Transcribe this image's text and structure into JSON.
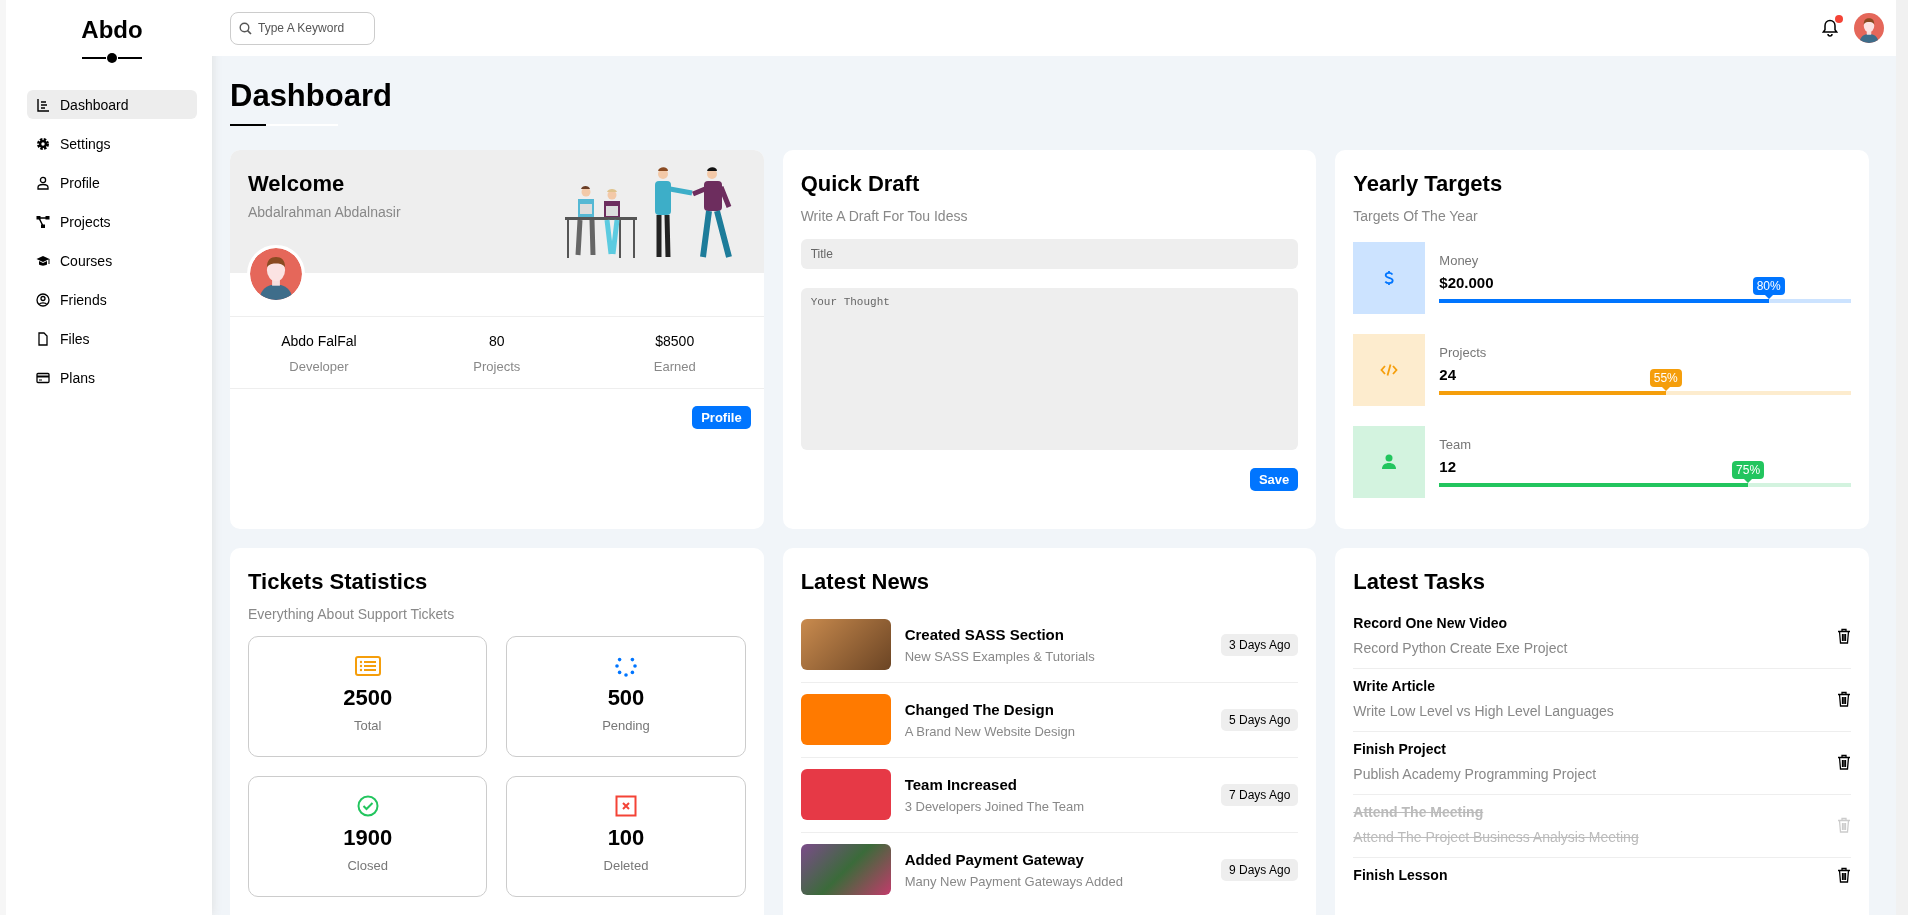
{
  "sidebar": {
    "logo": "Abdo",
    "items": [
      {
        "label": "Dashboard",
        "selected": true
      },
      {
        "label": "Settings",
        "selected": false
      },
      {
        "label": "Profile",
        "selected": false
      },
      {
        "label": "Projects",
        "selected": false
      },
      {
        "label": "Courses",
        "selected": false
      },
      {
        "label": "Friends",
        "selected": false
      },
      {
        "label": "Files",
        "selected": false
      },
      {
        "label": "Plans",
        "selected": false
      }
    ]
  },
  "header": {
    "search": {
      "placeholder": "Type A Keyword"
    },
    "notification": {
      "unread": true
    }
  },
  "page_title": "Dashboard",
  "welcome": {
    "title": "Welcome",
    "subtitle": "Abdalrahman Abdalnasir",
    "stats": [
      {
        "value": "Abdo FalFal",
        "label": "Developer"
      },
      {
        "value": "80",
        "label": "Projects"
      },
      {
        "value": "$8500",
        "label": "Earned"
      }
    ],
    "button": "Profile"
  },
  "quick_draft": {
    "title": "Quick Draft",
    "subtitle": "Write A Draft For Tou Idess",
    "title_field": {
      "placeholder": "Title"
    },
    "body_field": {
      "placeholder": "Your Thought"
    },
    "button": "Save"
  },
  "yearly_targets": {
    "title": "Yearly Targets",
    "subtitle": "Targets Of The Year",
    "items": [
      {
        "kind": "money",
        "label": "Money",
        "value": "$20.000",
        "level": 0.8,
        "badge": "80%",
        "color": "#0075ff"
      },
      {
        "kind": "code",
        "label": "Projects",
        "value": "24",
        "level": 0.55,
        "badge": "55%",
        "color": "#f59e0b"
      },
      {
        "kind": "team",
        "label": "Team",
        "value": "12",
        "level": 0.75,
        "badge": "75%",
        "color": "#22c55e"
      }
    ]
  },
  "tickets": {
    "title": "Tickets Statistics",
    "subtitle": "Everything About Support Tickets",
    "items": [
      {
        "kind": "total",
        "value": "2500",
        "label": "Total",
        "color": "#f59e0b"
      },
      {
        "kind": "pending",
        "value": "500",
        "label": "Pending",
        "color": "#0075ff"
      },
      {
        "kind": "closed",
        "value": "1900",
        "label": "Closed",
        "color": "#22c55e"
      },
      {
        "kind": "deleted",
        "value": "100",
        "label": "Deleted",
        "color": "#f44336"
      }
    ]
  },
  "news": {
    "title": "Latest News",
    "items": [
      {
        "title": "Created SASS Section",
        "text": "New SASS Examples & Tutorials",
        "time": "3 Days Ago"
      },
      {
        "title": "Changed The Design",
        "text": "A Brand New Website Design",
        "time": "5 Days Ago"
      },
      {
        "title": "Team Increased",
        "text": "3 Developers Joined The Team",
        "time": "7 Days Ago"
      },
      {
        "title": "Added Payment Gateway",
        "text": "Many New Payment Gateways Added",
        "time": "9 Days Ago"
      }
    ]
  },
  "tasks": {
    "title": "Latest Tasks",
    "items": [
      {
        "title": "Record One New Video",
        "text": "Record Python Create Exe Project",
        "done": false
      },
      {
        "title": "Write Article",
        "text": "Write Low Level vs High Level Languages",
        "done": false
      },
      {
        "title": "Finish Project",
        "text": "Publish Academy Programming Project",
        "done": false
      },
      {
        "title": "Attend The Meeting",
        "text": "Attend The Project Business Analysis Meeting",
        "done": true
      },
      {
        "title": "Finish Lesson",
        "done": false
      }
    ]
  }
}
